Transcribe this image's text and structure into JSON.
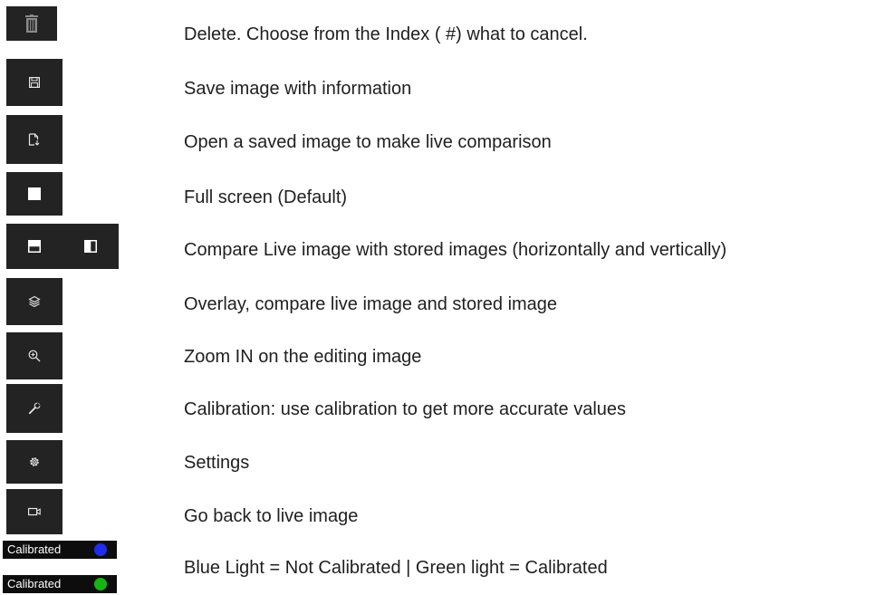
{
  "colors": {
    "tile_background": "#232323",
    "badge_background": "#0d0d0d",
    "dot_not_calibrated": "#1f2df0",
    "dot_calibrated": "#14b514"
  },
  "rows": [
    {
      "icon": "trash-icon",
      "text": "Delete. Choose from the Index ( #) what to cancel."
    },
    {
      "icon": "save-icon",
      "text": "Save image with information"
    },
    {
      "icon": "open-file-icon",
      "text": "Open a saved image to make live comparison"
    },
    {
      "icon": "full-screen-icon",
      "text": "Full screen (Default)"
    },
    {
      "icon": "split-horizontal-icon",
      "icon2": "split-vertical-icon",
      "text": "Compare Live image with stored images (horizontally and vertically)"
    },
    {
      "icon": "layers-icon",
      "text": "Overlay, compare live image and stored image"
    },
    {
      "icon": "zoom-in-icon",
      "text": "Zoom IN on the editing image"
    },
    {
      "icon": "wrench-icon",
      "text": "Calibration: use calibration to get more accurate values"
    },
    {
      "icon": "gear-icon",
      "text": "Settings"
    },
    {
      "icon": "video-camera-icon",
      "text": "Go back to live image"
    },
    {
      "text": "Blue Light = Not Calibrated | Green light = Calibrated"
    }
  ],
  "badges": [
    {
      "label": "Calibrated",
      "state": "not-calibrated"
    },
    {
      "label": "Calibrated",
      "state": "calibrated"
    }
  ]
}
